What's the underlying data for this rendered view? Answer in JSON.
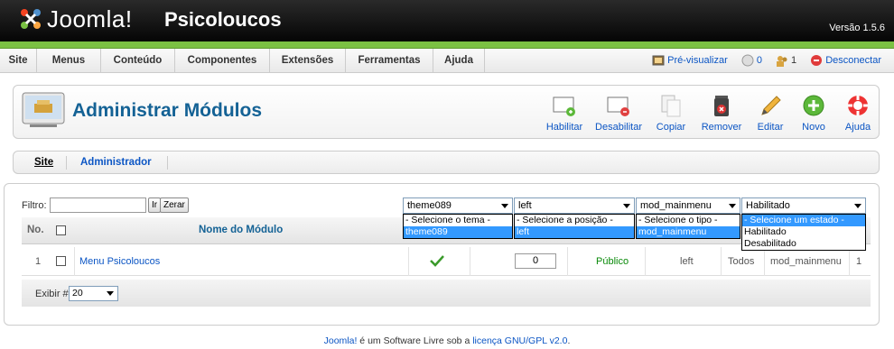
{
  "header": {
    "logo_text": "Joomla!",
    "site_name": "Psicoloucos",
    "version": "Versão 1.5.6"
  },
  "menu": {
    "items": [
      "Site",
      "Menus",
      "Conteúdo",
      "Componentes",
      "Extensões",
      "Ferramentas",
      "Ajuda"
    ],
    "preview": "Pré-visualizar",
    "messages_count": "0",
    "users_online": "1",
    "logout": "Desconectar"
  },
  "toolbar": {
    "title": "Administrar Módulos",
    "buttons": {
      "enable": "Habilitar",
      "disable": "Desabilitar",
      "copy": "Copiar",
      "remove": "Remover",
      "edit": "Editar",
      "new": "Novo",
      "help": "Ajuda"
    }
  },
  "submenu": {
    "site": "Site",
    "admin": "Administrador"
  },
  "filters": {
    "label": "Filtro:",
    "go": "Ir",
    "reset": "Zerar",
    "template": {
      "value": "theme089",
      "options": [
        "- Selecione o tema -",
        "theme089"
      ]
    },
    "position": {
      "value": "left",
      "options": [
        "- Selecione a posição -",
        "left"
      ]
    },
    "type": {
      "value": "mod_mainmenu",
      "options": [
        "- Selecione o tipo -",
        "mod_mainmenu"
      ]
    },
    "state": {
      "value": "Habilitado",
      "options": [
        "- Selecione um estado -",
        "Habilitado",
        "Desabilitado"
      ]
    }
  },
  "table": {
    "headers": {
      "num": "No.",
      "name": "Nome do Módulo"
    },
    "rows": [
      {
        "num": "1",
        "name": "Menu Psicoloucos",
        "order": "0",
        "access": "Público",
        "position": "left",
        "pages": "Todos",
        "type": "mod_mainmenu",
        "id": "1"
      }
    ],
    "footer_label": "Exibir #",
    "limit": "20"
  },
  "footer": {
    "brand": "Joomla!",
    "text": " é um Software Livre sob a ",
    "license": "licença GNU/GPL v2.0",
    "end": "."
  },
  "colors": {
    "title_blue": "#146295",
    "link_blue": "#0b55c4",
    "green_bar": "#7bc143",
    "published_green": "#0a8a0a",
    "highlight": "#3399ff"
  }
}
